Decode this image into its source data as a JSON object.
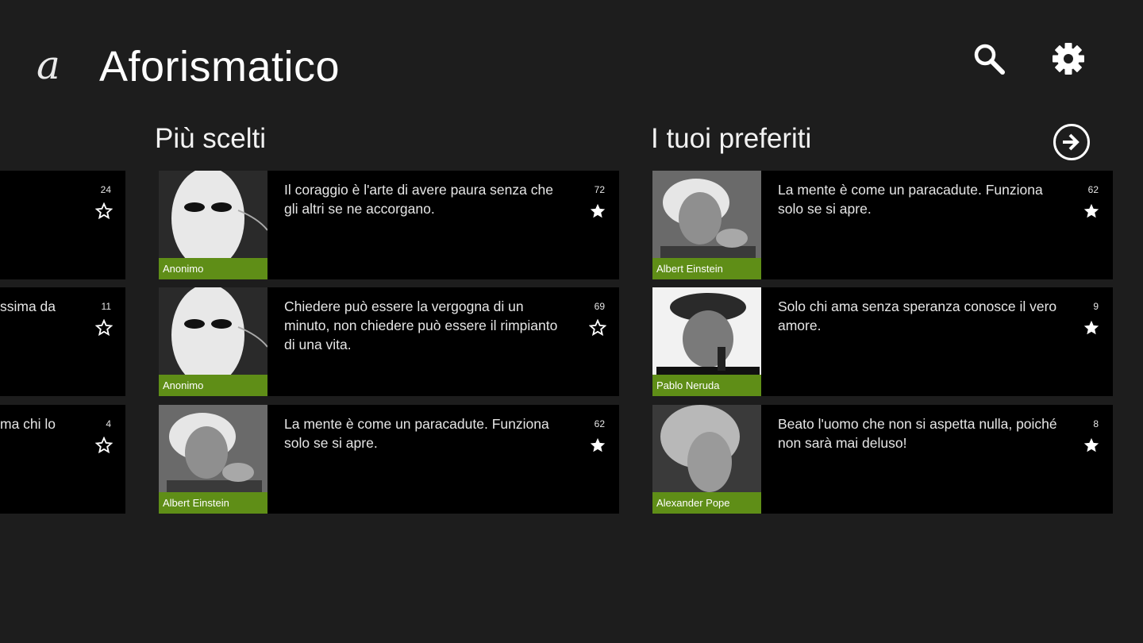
{
  "app": {
    "logo_letter": "a",
    "title": "Aforismatico",
    "search_icon": "search-icon",
    "settings_icon": "gear-icon"
  },
  "sections": {
    "most_chosen": {
      "title": "Più scelti"
    },
    "favorites": {
      "title": "I tuoi preferiti",
      "arrow_icon": "arrow-right-circle-icon"
    }
  },
  "left_partial": [
    {
      "text": "",
      "count": "24",
      "starred": false
    },
    {
      "text": "ssima da",
      "count": "11",
      "starred": false
    },
    {
      "text": "ma chi lo",
      "count": "4",
      "starred": false
    }
  ],
  "most_chosen_cards": [
    {
      "author": "Anonimo",
      "photo": "mask",
      "quote": "Il coraggio è l'arte di avere paura senza che gli altri se ne accorgano.",
      "count": "72",
      "starred": true
    },
    {
      "author": "Anonimo",
      "photo": "mask",
      "quote": "Chiedere può essere la vergogna di un minuto, non chiedere può essere il rimpianto di una vita.",
      "count": "69",
      "starred": false
    },
    {
      "author": "Albert Einstein",
      "photo": "einstein",
      "quote": "La mente è come un paracadute. Funziona solo se si apre.",
      "count": "62",
      "starred": true
    }
  ],
  "favorite_cards": [
    {
      "author": "Albert Einstein",
      "photo": "einstein",
      "quote": "La mente è come un paracadute. Funziona solo se si apre.",
      "count": "62",
      "starred": true
    },
    {
      "author": "Pablo Neruda",
      "photo": "neruda",
      "quote": "Solo chi ama senza speranza conosce il vero amore.",
      "count": "9",
      "starred": true
    },
    {
      "author": "Alexander Pope",
      "photo": "pope",
      "quote": "Beato l'uomo che non si aspetta nulla, poiché non sarà mai deluso!",
      "count": "8",
      "starred": true
    }
  ],
  "colors": {
    "background": "#1d1d1d",
    "card": "#000000",
    "accent": "#5f8e17"
  }
}
